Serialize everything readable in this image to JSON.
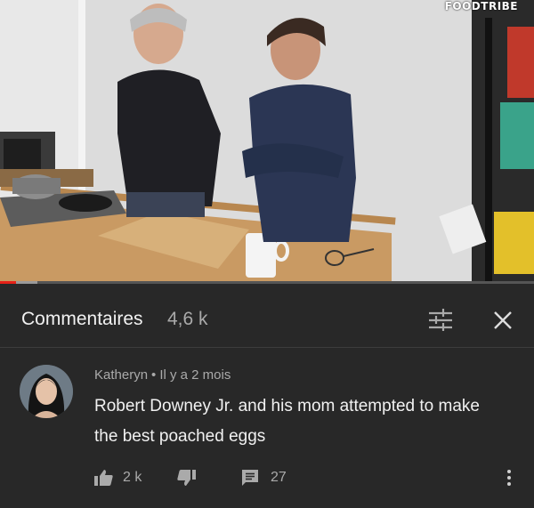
{
  "video": {
    "channel_logo_text": "FOODTRIBE",
    "progress_percent": 3,
    "buffer_percent": 4
  },
  "comments_panel": {
    "title": "Commentaires",
    "count": "4,6 k",
    "filter_icon": "sort-filter-icon",
    "close_icon": "close-icon"
  },
  "comment": {
    "author": "Katheryn",
    "separator": "•",
    "time": "Il y a 2 mois",
    "text": "Robert Downey Jr. and his mom attempted to make the best poached eggs",
    "likes": "2 k",
    "replies": "27",
    "like_icon": "thumbs-up-icon",
    "dislike_icon": "thumbs-down-icon",
    "reply_icon": "comment-icon",
    "more_icon": "more-vertical-icon"
  },
  "colors": {
    "panel_bg": "#282828",
    "primary_text": "#f1f1f1",
    "secondary_text": "#aaaaaa",
    "progress_red": "#e62117"
  }
}
